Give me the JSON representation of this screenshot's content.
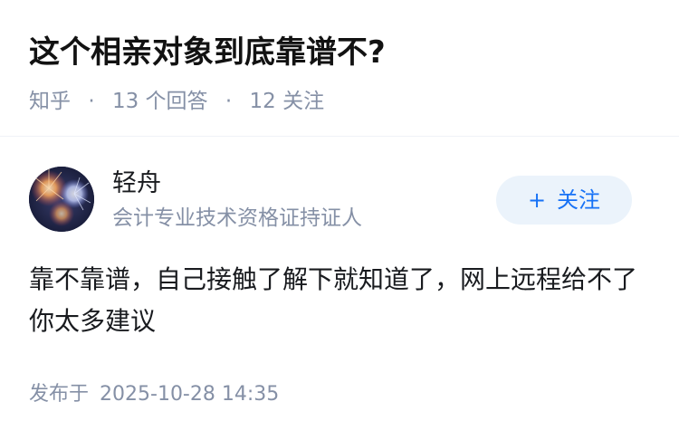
{
  "question": {
    "title": "这个相亲对象到底靠谱不?",
    "source": "知乎",
    "separator": "·",
    "answers_count": "13",
    "answers_label": "个回答",
    "follows_count": "12",
    "follows_label": "关注"
  },
  "author": {
    "name": "轻舟",
    "bio": "会计专业技术资格证持证人",
    "follow_icon": "+",
    "follow_label": "关注"
  },
  "answer": {
    "content": "靠不靠谱，自己接触了解下就知道了，网上远程给不了你太多建议",
    "published_label": "发布于",
    "published_time": "2025-10-28 14:35"
  },
  "colors": {
    "accent": "#1772f6",
    "follow_bg": "#ebf3fb",
    "meta_gray": "#8590a6"
  }
}
